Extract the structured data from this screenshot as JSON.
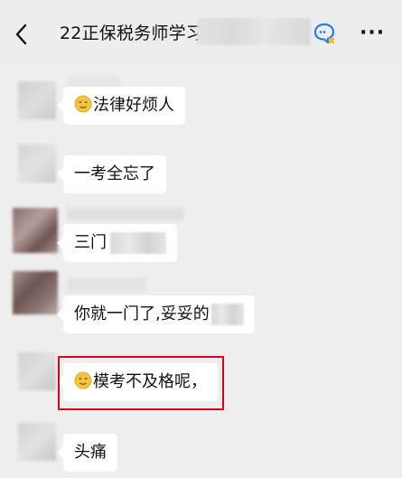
{
  "header": {
    "back_icon": "chevron-left-icon",
    "title": "22正保税务师学习",
    "chat_icon": "chat-bubble-icon",
    "more_label": "···"
  },
  "messages": [
    {
      "text": "法律好烦人",
      "emoji": "sweat-smile-emoji"
    },
    {
      "text": "一考全忘了"
    },
    {
      "text": "三门"
    },
    {
      "text": "你就一门了,妥妥的"
    },
    {
      "text": "模考不及格呢，",
      "emoji": "sweat-smile-emoji",
      "highlighted": true
    },
    {
      "text": "头痛"
    }
  ],
  "colors": {
    "background": "#eeeeee",
    "bubble": "#ffffff",
    "highlight_border": "#d9001b",
    "chat_icon_blue": "#2a7de1",
    "chat_icon_yellow": "#f2b400"
  }
}
